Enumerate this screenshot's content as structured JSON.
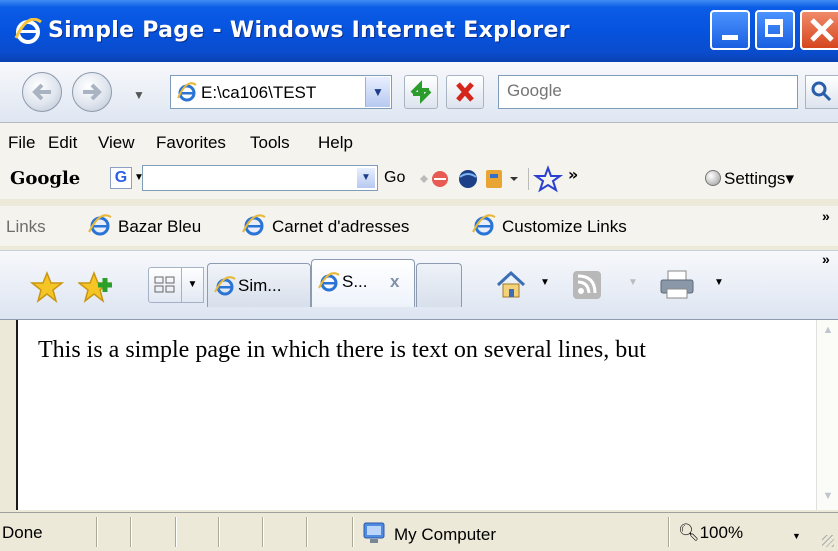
{
  "window": {
    "title": "Simple Page - Windows Internet Explorer"
  },
  "address_bar": {
    "value": "E:\\ca106\\TEST",
    "search_placeholder": "Google"
  },
  "menu": {
    "items": [
      "File",
      "Edit",
      "View",
      "Favorites",
      "Tools",
      "Help"
    ]
  },
  "google_toolbar": {
    "logo": "Google",
    "g_button": "G",
    "go_label": "Go",
    "settings_label": "Settings"
  },
  "links_bar": {
    "label": "Links",
    "items": [
      "Bazar Bleu",
      "Carnet d'adresses",
      "Customize Links"
    ]
  },
  "tabs": [
    {
      "label": "Sim..."
    },
    {
      "label": "S...",
      "close": "x"
    }
  ],
  "content": {
    "text": "This is a simple page in which there is text on several lines, but"
  },
  "status_bar": {
    "status": "Done",
    "zone": "My Computer",
    "zoom": "100%"
  },
  "colors": {
    "titlebar": "#0653de",
    "close_button": "#d5461d",
    "chrome": "#ece9d8"
  }
}
